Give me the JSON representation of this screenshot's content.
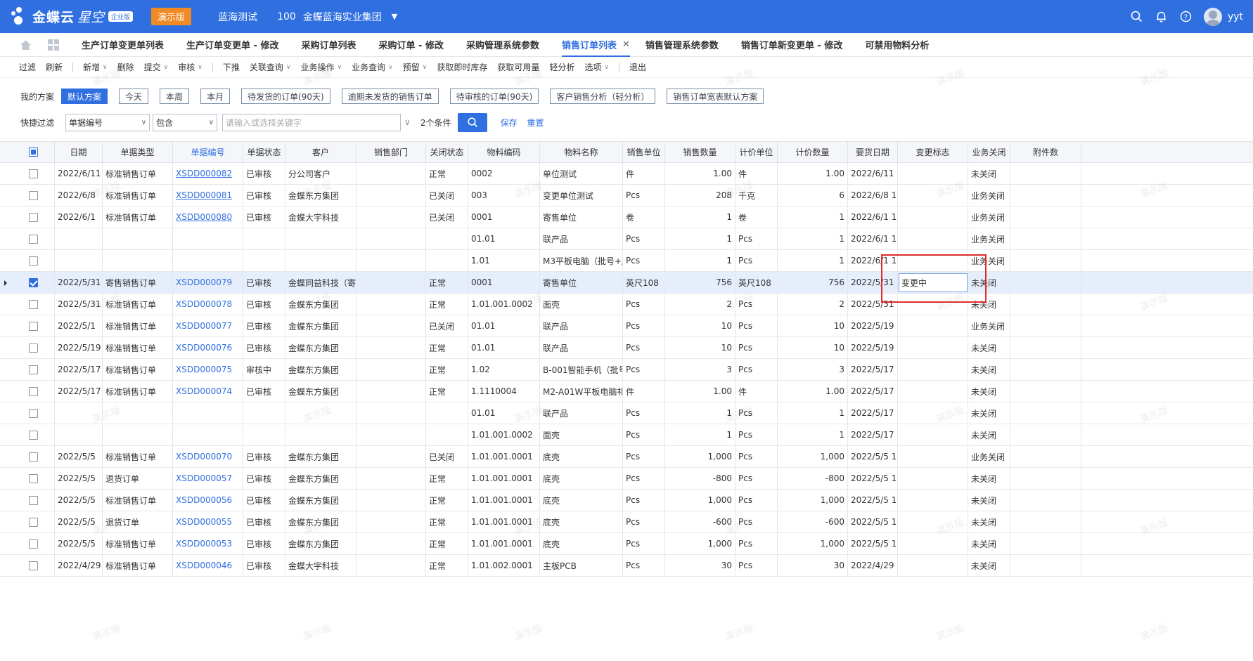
{
  "app": {
    "logo_text": "金蝶云",
    "logo_sub": "星空",
    "edition_badge": "企业版",
    "demo_label": "演示版",
    "tenant": "蓝海测试",
    "org_code": "100",
    "org_name": "金蝶蓝海实业集团",
    "username": "yyt"
  },
  "tabs": [
    {
      "label": "生产订单变更单列表"
    },
    {
      "label": "生产订单变更单 - 修改"
    },
    {
      "label": "采购订单列表"
    },
    {
      "label": "采购订单 - 修改"
    },
    {
      "label": "采购管理系统参数"
    },
    {
      "label": "销售订单列表",
      "active": true
    },
    {
      "label": "销售管理系统参数"
    },
    {
      "label": "销售订单新变更单 - 修改"
    },
    {
      "label": "可禁用物料分析"
    }
  ],
  "toolbar": {
    "filter": "过滤",
    "refresh": "刷新",
    "new": "新增",
    "delete": "删除",
    "submit": "提交",
    "audit": "审核",
    "push": "下推",
    "related_query": "关联查询",
    "business_ops": "业务操作",
    "business_query": "业务查询",
    "reserve": "预留",
    "realtime_stock": "获取即时库存",
    "available_qty": "获取可用量",
    "light_analysis": "轻分析",
    "options": "选项",
    "exit": "退出"
  },
  "scheme": {
    "label": "我的方案",
    "chips": [
      "默认方案",
      "今天",
      "本周",
      "本月",
      "待发货的订单(90天)",
      "逾期未发货的销售订单",
      "待审核的订单(90天)",
      "客户销售分析（轻分析）",
      "销售订单宽表默认方案"
    ]
  },
  "quick_filter": {
    "label": "快捷过滤",
    "field": "单据编号",
    "operator": "包含",
    "placeholder": "请输入或选择关键字",
    "conditions": "2个条件",
    "save": "保存",
    "reset": "重置"
  },
  "columns": [
    "日期",
    "单据类型",
    "单据编号",
    "单据状态",
    "客户",
    "销售部门",
    "关闭状态",
    "物料编码",
    "物料名称",
    "销售单位",
    "销售数量",
    "计价单位",
    "计价数量",
    "要货日期",
    "变更标志",
    "业务关闭",
    "附件数"
  ],
  "rows": [
    {
      "checked": false,
      "date": "2022/6/11",
      "type": "标准销售订单",
      "code": "XSDD000082",
      "status": "已审核",
      "customer": "分公司客户",
      "dept": "",
      "close": "正常",
      "mat_code": "0002",
      "mat_name": "单位测试",
      "unit": "件",
      "qty": "1.00",
      "price_unit": "件",
      "price_qty": "1.00",
      "req_date": "2022/6/11 (",
      "change": "",
      "biz_close": "未关闭",
      "attach": "",
      "code_underline": true
    },
    {
      "checked": false,
      "date": "2022/6/8",
      "type": "标准销售订单",
      "code": "XSDD000081",
      "status": "已审核",
      "customer": "金蝶东方集团",
      "dept": "",
      "close": "已关闭",
      "mat_code": "003",
      "mat_name": "变更单位测试",
      "unit": "Pcs",
      "qty": "208",
      "price_unit": "千克",
      "price_qty": "6",
      "req_date": "2022/6/8 1(",
      "change": "",
      "biz_close": "业务关闭",
      "attach": "",
      "code_underline": true
    },
    {
      "checked": false,
      "date": "2022/6/1",
      "type": "标准销售订单",
      "code": "XSDD000080",
      "status": "已审核",
      "customer": "金蝶大宇科技",
      "dept": "",
      "close": "已关闭",
      "mat_code": "0001",
      "mat_name": "寄售单位",
      "unit": "卷",
      "qty": "1",
      "price_unit": "卷",
      "price_qty": "1",
      "req_date": "2022/6/1 1(",
      "change": "",
      "biz_close": "业务关闭",
      "attach": "",
      "code_underline": true
    },
    {
      "checked": false,
      "date": "",
      "type": "",
      "code": "",
      "status": "",
      "customer": "",
      "dept": "",
      "close": "",
      "mat_code": "01.01",
      "mat_name": "联产品",
      "unit": "Pcs",
      "qty": "1",
      "price_unit": "Pcs",
      "price_qty": "1",
      "req_date": "2022/6/1 1(",
      "change": "",
      "biz_close": "业务关闭",
      "attach": ""
    },
    {
      "checked": false,
      "date": "",
      "type": "",
      "code": "",
      "status": "",
      "customer": "",
      "dept": "",
      "close": "",
      "mat_code": "1.01",
      "mat_name": "M3平板电脑（批号+/",
      "unit": "Pcs",
      "qty": "1",
      "price_unit": "Pcs",
      "price_qty": "1",
      "req_date": "2022/6/1 1(",
      "change": "",
      "biz_close": "业务关闭",
      "attach": ""
    },
    {
      "checked": true,
      "selected": true,
      "date": "2022/5/31",
      "type": "寄售销售订单",
      "code": "XSDD000079",
      "status": "已审核",
      "customer": "金蝶同益科技（寄",
      "dept": "",
      "close": "正常",
      "mat_code": "0001",
      "mat_name": "寄售单位",
      "unit": "英尺108",
      "qty": "756",
      "price_unit": "英尺108",
      "price_qty": "756",
      "req_date": "2022/5/31 1",
      "change": "变更中",
      "biz_close": "未关闭",
      "attach": ""
    },
    {
      "checked": false,
      "date": "2022/5/31",
      "type": "标准销售订单",
      "code": "XSDD000078",
      "status": "已审核",
      "customer": "金蝶东方集团",
      "dept": "",
      "close": "正常",
      "mat_code": "1.01.001.0002",
      "mat_name": "面壳",
      "unit": "Pcs",
      "qty": "2",
      "price_unit": "Pcs",
      "price_qty": "2",
      "req_date": "2022/5/31 ",
      "change": "",
      "biz_close": "未关闭",
      "attach": ""
    },
    {
      "checked": false,
      "date": "2022/5/1",
      "type": "标准销售订单",
      "code": "XSDD000077",
      "status": "已审核",
      "customer": "金蝶东方集团",
      "dept": "",
      "close": "已关闭",
      "mat_code": "01.01",
      "mat_name": "联产品",
      "unit": "Pcs",
      "qty": "10",
      "price_unit": "Pcs",
      "price_qty": "10",
      "req_date": "2022/5/19 ",
      "change": "",
      "biz_close": "业务关闭",
      "attach": ""
    },
    {
      "checked": false,
      "date": "2022/5/19",
      "type": "标准销售订单",
      "code": "XSDD000076",
      "status": "已审核",
      "customer": "金蝶东方集团",
      "dept": "",
      "close": "正常",
      "mat_code": "01.01",
      "mat_name": "联产品",
      "unit": "Pcs",
      "qty": "10",
      "price_unit": "Pcs",
      "price_qty": "10",
      "req_date": "2022/5/19 ",
      "change": "",
      "biz_close": "未关闭",
      "attach": ""
    },
    {
      "checked": false,
      "date": "2022/5/17",
      "type": "标准销售订单",
      "code": "XSDD000075",
      "status": "审核中",
      "customer": "金蝶东方集团",
      "dept": "",
      "close": "正常",
      "mat_code": "1.02",
      "mat_name": "B-001智能手机（批号",
      "unit": "Pcs",
      "qty": "3",
      "price_unit": "Pcs",
      "price_qty": "3",
      "req_date": "2022/5/17 ",
      "change": "",
      "biz_close": "未关闭",
      "attach": ""
    },
    {
      "checked": false,
      "date": "2022/5/17",
      "type": "标准销售订单",
      "code": "XSDD000074",
      "status": "已审核",
      "customer": "金蝶东方集团",
      "dept": "",
      "close": "正常",
      "mat_code": "1.1110004",
      "mat_name": "M2-A01W平板电脑礼",
      "unit": "件",
      "qty": "1.00",
      "price_unit": "件",
      "price_qty": "1.00",
      "req_date": "2022/5/17 ",
      "change": "",
      "biz_close": "未关闭",
      "attach": ""
    },
    {
      "checked": false,
      "date": "",
      "type": "",
      "code": "",
      "status": "",
      "customer": "",
      "dept": "",
      "close": "",
      "mat_code": "01.01",
      "mat_name": "联产品",
      "unit": "Pcs",
      "qty": "1",
      "price_unit": "Pcs",
      "price_qty": "1",
      "req_date": "2022/5/17 ",
      "change": "",
      "biz_close": "未关闭",
      "attach": ""
    },
    {
      "checked": false,
      "date": "",
      "type": "",
      "code": "",
      "status": "",
      "customer": "",
      "dept": "",
      "close": "",
      "mat_code": "1.01.001.0002",
      "mat_name": "面壳",
      "unit": "Pcs",
      "qty": "1",
      "price_unit": "Pcs",
      "price_qty": "1",
      "req_date": "2022/5/17 ",
      "change": "",
      "biz_close": "未关闭",
      "attach": ""
    },
    {
      "checked": false,
      "date": "2022/5/5",
      "type": "标准销售订单",
      "code": "XSDD000070",
      "status": "已审核",
      "customer": "金蝶东方集团",
      "dept": "",
      "close": "已关闭",
      "mat_code": "1.01.001.0001",
      "mat_name": "底壳",
      "unit": "Pcs",
      "qty": "1,000",
      "price_unit": "Pcs",
      "price_qty": "1,000",
      "req_date": "2022/5/5 1!",
      "change": "",
      "biz_close": "业务关闭",
      "attach": ""
    },
    {
      "checked": false,
      "date": "2022/5/5",
      "type": "退货订单",
      "code": "XSDD000057",
      "status": "已审核",
      "customer": "金蝶东方集团",
      "dept": "",
      "close": "正常",
      "mat_code": "1.01.001.0001",
      "mat_name": "底壳",
      "unit": "Pcs",
      "qty": "-800",
      "price_unit": "Pcs",
      "price_qty": "-800",
      "req_date": "2022/5/5 1!",
      "change": "",
      "biz_close": "未关闭",
      "attach": ""
    },
    {
      "checked": false,
      "date": "2022/5/5",
      "type": "标准销售订单",
      "code": "XSDD000056",
      "status": "已审核",
      "customer": "金蝶东方集团",
      "dept": "",
      "close": "正常",
      "mat_code": "1.01.001.0001",
      "mat_name": "底壳",
      "unit": "Pcs",
      "qty": "1,000",
      "price_unit": "Pcs",
      "price_qty": "1,000",
      "req_date": "2022/5/5 1!",
      "change": "",
      "biz_close": "未关闭",
      "attach": ""
    },
    {
      "checked": false,
      "date": "2022/5/5",
      "type": "退货订单",
      "code": "XSDD000055",
      "status": "已审核",
      "customer": "金蝶东方集团",
      "dept": "",
      "close": "正常",
      "mat_code": "1.01.001.0001",
      "mat_name": "底壳",
      "unit": "Pcs",
      "qty": "-600",
      "price_unit": "Pcs",
      "price_qty": "-600",
      "req_date": "2022/5/5 1!",
      "change": "",
      "biz_close": "未关闭",
      "attach": ""
    },
    {
      "checked": false,
      "date": "2022/5/5",
      "type": "标准销售订单",
      "code": "XSDD000053",
      "status": "已审核",
      "customer": "金蝶东方集团",
      "dept": "",
      "close": "正常",
      "mat_code": "1.01.001.0001",
      "mat_name": "底壳",
      "unit": "Pcs",
      "qty": "1,000",
      "price_unit": "Pcs",
      "price_qty": "1,000",
      "req_date": "2022/5/5 1!",
      "change": "",
      "biz_close": "未关闭",
      "attach": ""
    },
    {
      "checked": false,
      "date": "2022/4/29",
      "type": "标准销售订单",
      "code": "XSDD000046",
      "status": "已审核",
      "customer": "金蝶大宇科技",
      "dept": "",
      "close": "正常",
      "mat_code": "1.01.002.0001",
      "mat_name": "主板PCB",
      "unit": "Pcs",
      "qty": "30",
      "price_unit": "Pcs",
      "price_qty": "30",
      "req_date": "2022/4/29 ",
      "change": "",
      "biz_close": "未关闭",
      "attach": ""
    }
  ],
  "watermark_text": "演示版"
}
